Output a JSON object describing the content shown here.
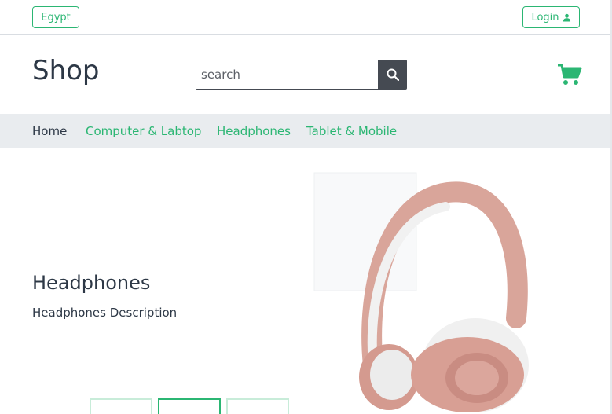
{
  "topbar": {
    "country": "Egypt",
    "login_label": "Login"
  },
  "header": {
    "brand": "Shop",
    "search_placeholder": "search"
  },
  "nav": {
    "items": [
      {
        "label": "Home",
        "active": true
      },
      {
        "label": "Computer & Labtop",
        "active": false
      },
      {
        "label": "Headphones",
        "active": false
      },
      {
        "label": "Tablet & Mobile",
        "active": false
      }
    ]
  },
  "hero": {
    "title": "Headphones",
    "description": "Headphones Description",
    "slides_count": 3,
    "active_slide": 2
  },
  "colors": {
    "accent": "#2bb673",
    "nav_bg": "#e9ecef",
    "search_bg": "#454a52"
  },
  "icons": [
    "user-icon",
    "search-icon",
    "cart-icon"
  ]
}
